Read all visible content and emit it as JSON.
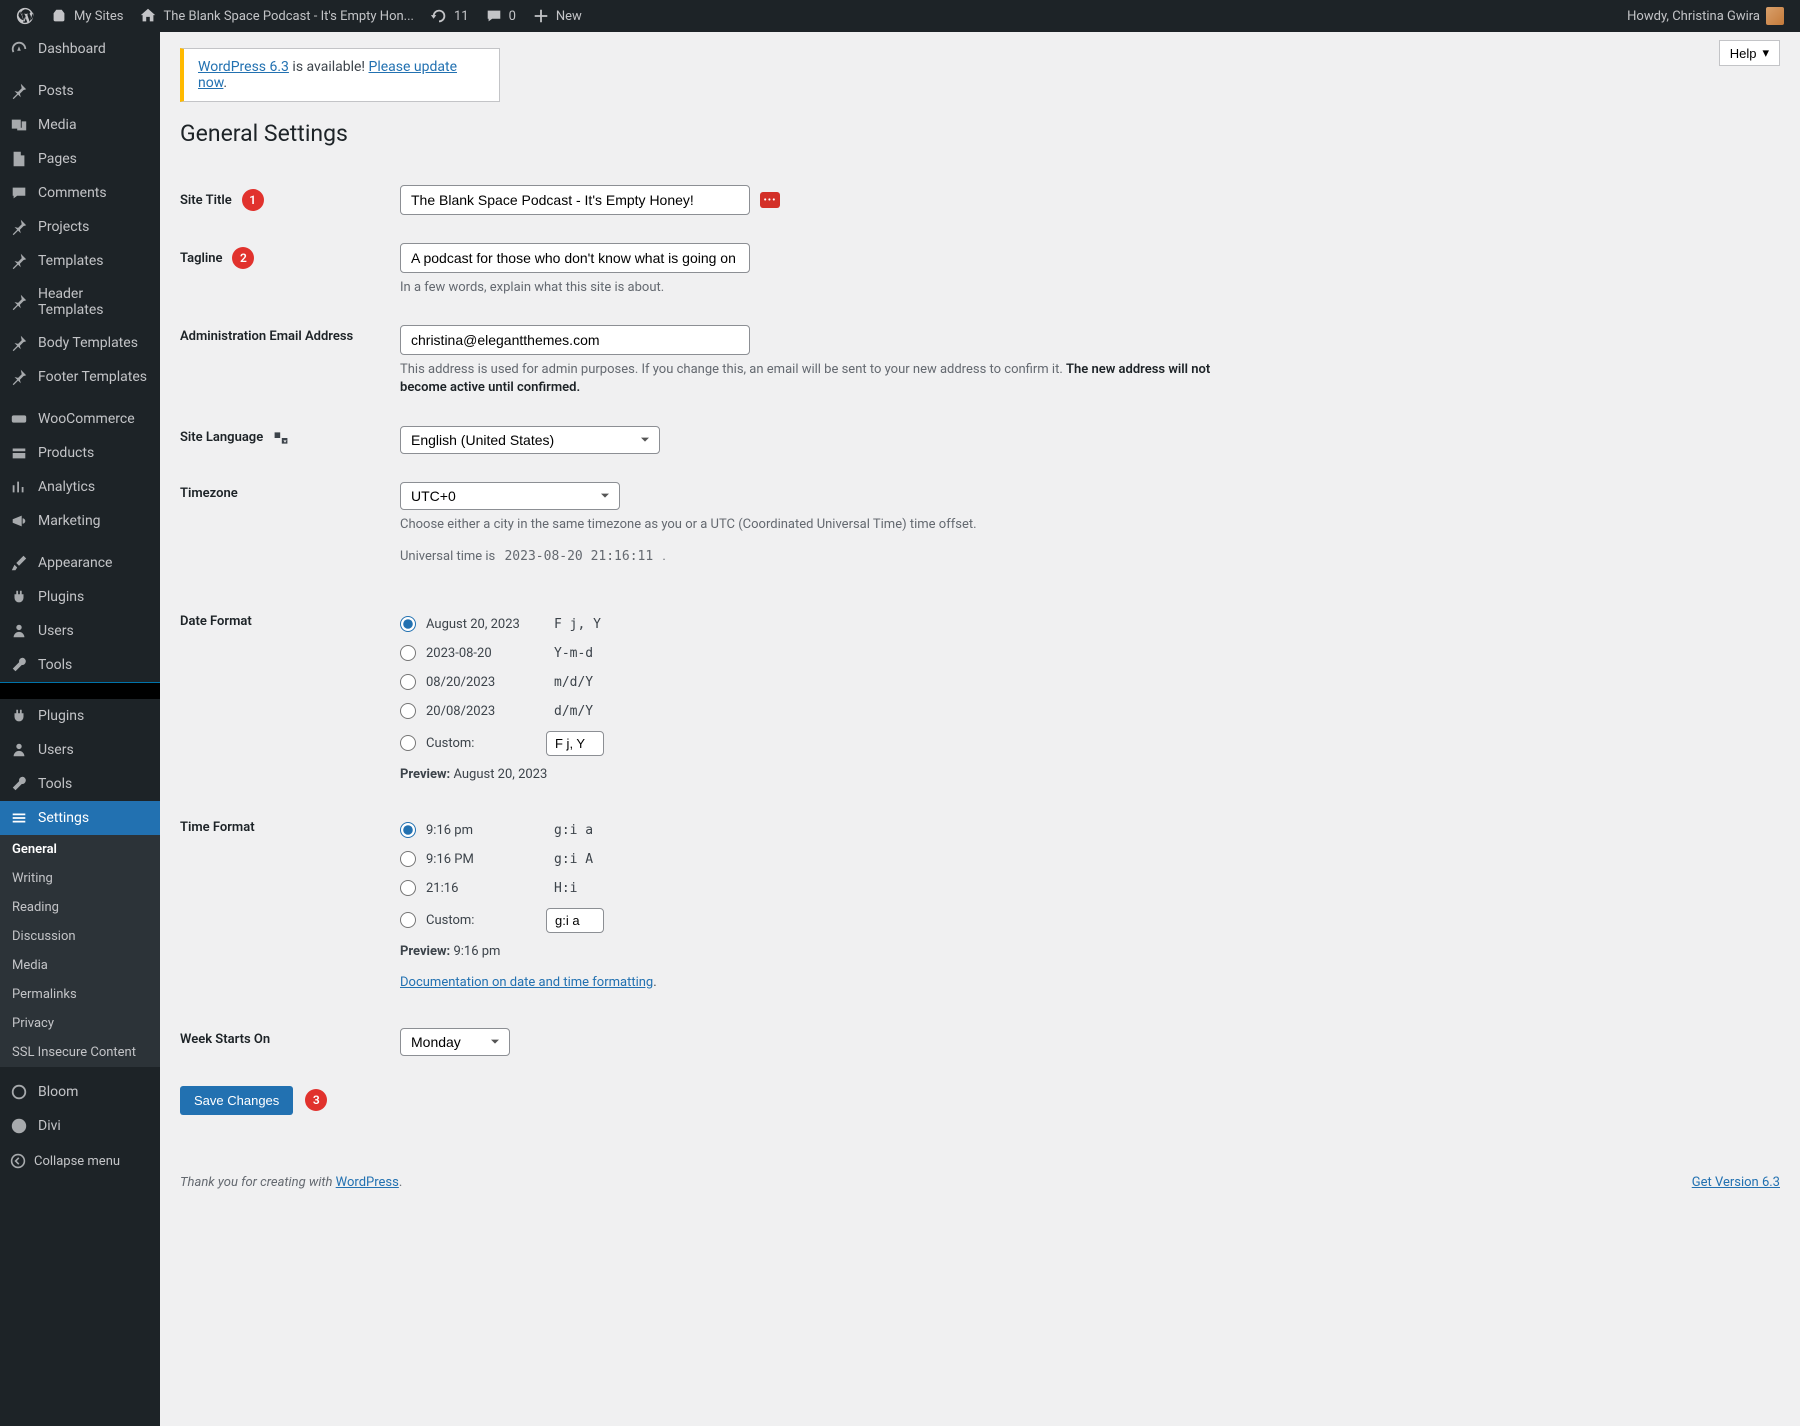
{
  "adminbar": {
    "my_sites": "My Sites",
    "site_title": "The Blank Space Podcast - It's Empty Hon...",
    "updates": "11",
    "comments": "0",
    "new": "New",
    "howdy": "Howdy, Christina Gwira"
  },
  "sidebar": {
    "dashboard": "Dashboard",
    "posts": "Posts",
    "media": "Media",
    "pages": "Pages",
    "comments": "Comments",
    "projects": "Projects",
    "templates": "Templates",
    "header_templates": "Header Templates",
    "body_templates": "Body Templates",
    "footer_templates": "Footer Templates",
    "woocommerce": "WooCommerce",
    "products": "Products",
    "analytics": "Analytics",
    "marketing": "Marketing",
    "appearance": "Appearance",
    "plugins": "Plugins",
    "users": "Users",
    "tools": "Tools",
    "plugins2": "Plugins",
    "users2": "Users",
    "tools2": "Tools",
    "settings": "Settings",
    "bloom": "Bloom",
    "divi": "Divi",
    "collapse": "Collapse menu",
    "submenu": {
      "general": "General",
      "writing": "Writing",
      "reading": "Reading",
      "discussion": "Discussion",
      "media": "Media",
      "permalinks": "Permalinks",
      "privacy": "Privacy",
      "ssl": "SSL Insecure Content"
    }
  },
  "help": "Help",
  "notice": {
    "prefix": "WordPress 6.3",
    "mid": " is available! ",
    "link": "Please update now"
  },
  "page_title": "General Settings",
  "labels": {
    "site_title": "Site Title",
    "tagline": "Tagline",
    "admin_email": "Administration Email Address",
    "site_language": "Site Language",
    "timezone": "Timezone",
    "date_format": "Date Format",
    "time_format": "Time Format",
    "week_starts": "Week Starts On"
  },
  "fields": {
    "site_title": "The Blank Space Podcast - It's Empty Honey!",
    "tagline": "A podcast for those who don't know what is going on",
    "tagline_desc": "In a few words, explain what this site is about.",
    "admin_email": "christina@elegantthemes.com",
    "admin_email_desc_1": "This address is used for admin purposes. If you change this, an email will be sent to your new address to confirm it. ",
    "admin_email_desc_2": "The new address will not become active until confirmed.",
    "language": "English (United States)",
    "timezone": "UTC+0",
    "timezone_desc": "Choose either a city in the same timezone as you or a UTC (Coordinated Universal Time) time offset.",
    "utc_prefix": "Universal time is ",
    "utc_time": "2023-08-20 21:16:11",
    "custom_label": "Custom:",
    "preview_label": "Preview:",
    "doc_link": "Documentation on date and time formatting",
    "week_value": "Monday"
  },
  "date_formats": [
    {
      "label": "August 20, 2023",
      "fmt": "F j, Y",
      "checked": true
    },
    {
      "label": "2023-08-20",
      "fmt": "Y-m-d",
      "checked": false
    },
    {
      "label": "08/20/2023",
      "fmt": "m/d/Y",
      "checked": false
    },
    {
      "label": "20/08/2023",
      "fmt": "d/m/Y",
      "checked": false
    }
  ],
  "date_custom": "F j, Y",
  "date_preview": "August 20, 2023",
  "time_formats": [
    {
      "label": "9:16 pm",
      "fmt": "g:i a",
      "checked": true
    },
    {
      "label": "9:16 PM",
      "fmt": "g:i A",
      "checked": false
    },
    {
      "label": "21:16",
      "fmt": "H:i",
      "checked": false
    }
  ],
  "time_custom": "g:i a",
  "time_preview": "9:16 pm",
  "save": "Save Changes",
  "footer": {
    "thank": "Thank you for creating with ",
    "wp": "WordPress",
    "version": "Get Version 6.3"
  },
  "annot": {
    "1": "1",
    "2": "2",
    "3": "3"
  }
}
